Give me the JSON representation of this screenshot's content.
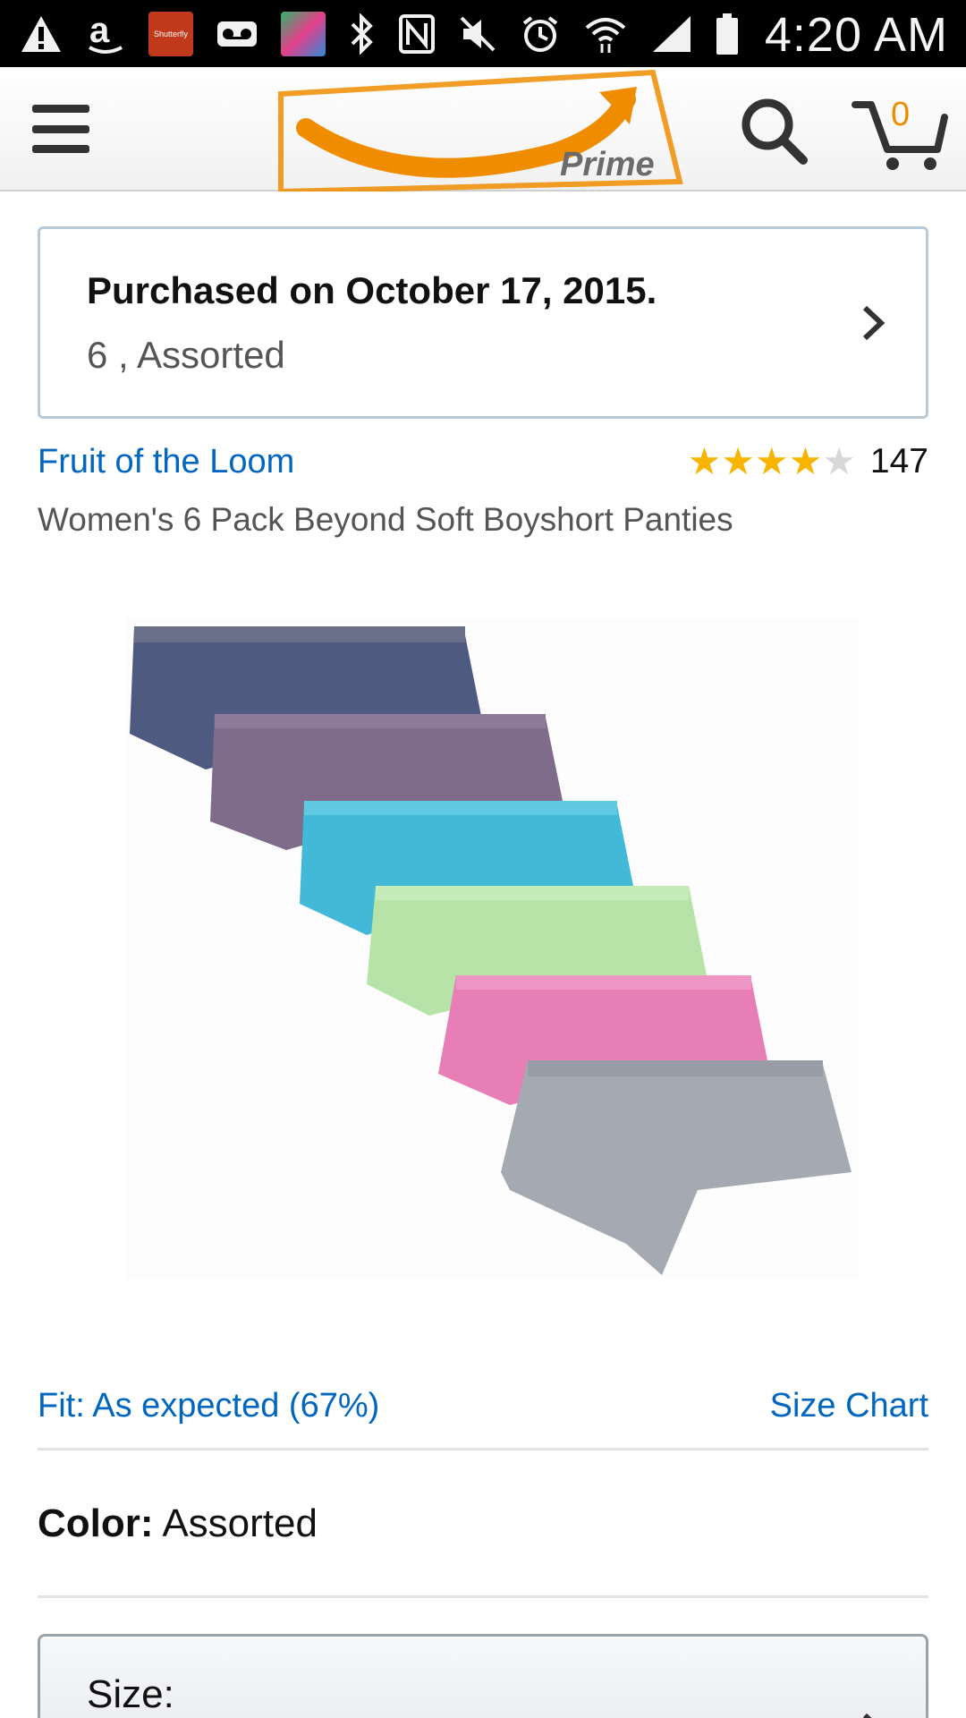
{
  "status_bar": {
    "time": "4:20 AM",
    "shutterfly_label": "Shutterfly",
    "icons": [
      "warning-icon",
      "amazon-icon",
      "shutterfly-icon",
      "voicemail-icon",
      "candy-app-icon",
      "bluetooth-icon",
      "nfc-icon",
      "mute-icon",
      "alarm-icon",
      "wifi-icon",
      "signal-icon",
      "battery-icon"
    ]
  },
  "app_bar": {
    "logo_text": "Prime",
    "cart_count": "0",
    "accent_color": "#f08c00"
  },
  "purchase": {
    "title": "Purchased on October 17, 2015.",
    "subtitle": "6 , Assorted"
  },
  "product": {
    "brand": "Fruit of the Loom",
    "rating_stars": 4,
    "rating_max": 5,
    "review_count": "147",
    "title": "Women's 6 Pack Beyond Soft Boyshort Panties",
    "image_swatches": [
      "#4f5a80",
      "#7e6c8a",
      "#43b9d8",
      "#b6e3a8",
      "#e87eb6",
      "#a5a9b2"
    ]
  },
  "fit": {
    "label": "Fit: As expected (67%)",
    "size_chart": "Size Chart"
  },
  "color": {
    "label": "Color:",
    "value": "Assorted"
  },
  "size": {
    "label": "Size:"
  },
  "colors": {
    "link": "#0066c0",
    "star": "#f7b500",
    "border": "#b7cad6"
  }
}
